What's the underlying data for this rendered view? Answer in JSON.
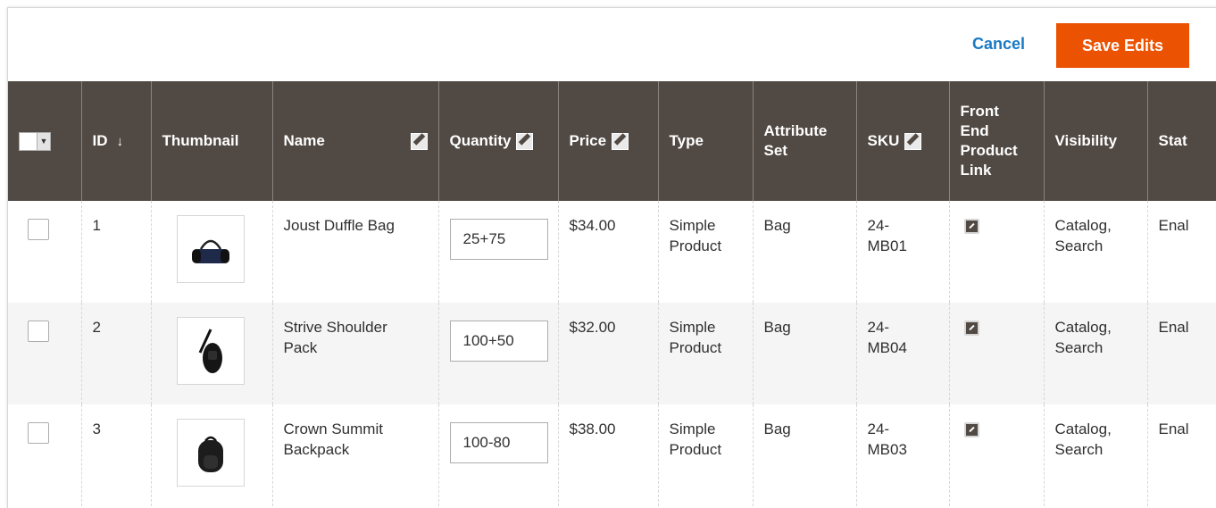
{
  "actions": {
    "cancel_label": "Cancel",
    "save_label": "Save Edits"
  },
  "columns": {
    "id": "ID",
    "thumbnail": "Thumbnail",
    "name": "Name",
    "quantity": "Quantity",
    "price": "Price",
    "type": "Type",
    "attribute_set_1": "Attribute",
    "attribute_set_2": "Set",
    "sku": "SKU",
    "front_1": "Front",
    "front_2": "End",
    "front_3": "Product",
    "front_4": "Link",
    "visibility": "Visibility",
    "status": "Stat"
  },
  "icons": {
    "sort": "sort-descending-arrow-icon",
    "edit": "pencil-edit-icon",
    "link": "external-link-icon",
    "mass_select": "chevron-down-icon"
  },
  "colors": {
    "header_bg": "#514943",
    "accent": "#eb5202",
    "link": "#1979c3"
  },
  "rows": [
    {
      "id": "1",
      "name": "Joust Duffle Bag",
      "quantity": "25+75",
      "price": "$34.00",
      "type_1": "Simple",
      "type_2": "Product",
      "attribute_set": "Bag",
      "sku_1": "24-",
      "sku_2": "MB01",
      "visibility_1": "Catalog,",
      "visibility_2": "Search",
      "status": "Enal",
      "thumbnail": "duffle-bag-image"
    },
    {
      "id": "2",
      "name_1": "Strive Shoulder",
      "name_2": "Pack",
      "quantity": "100+50",
      "price": "$32.00",
      "type_1": "Simple",
      "type_2": "Product",
      "attribute_set": "Bag",
      "sku_1": "24-",
      "sku_2": "MB04",
      "visibility_1": "Catalog,",
      "visibility_2": "Search",
      "status": "Enal",
      "thumbnail": "shoulder-pack-image"
    },
    {
      "id": "3",
      "name_1": "Crown Summit",
      "name_2": "Backpack",
      "quantity": "100-80",
      "price": "$38.00",
      "type_1": "Simple",
      "type_2": "Product",
      "attribute_set": "Bag",
      "sku_1": "24-",
      "sku_2": "MB03",
      "visibility_1": "Catalog,",
      "visibility_2": "Search",
      "status": "Enal",
      "thumbnail": "backpack-image"
    }
  ]
}
